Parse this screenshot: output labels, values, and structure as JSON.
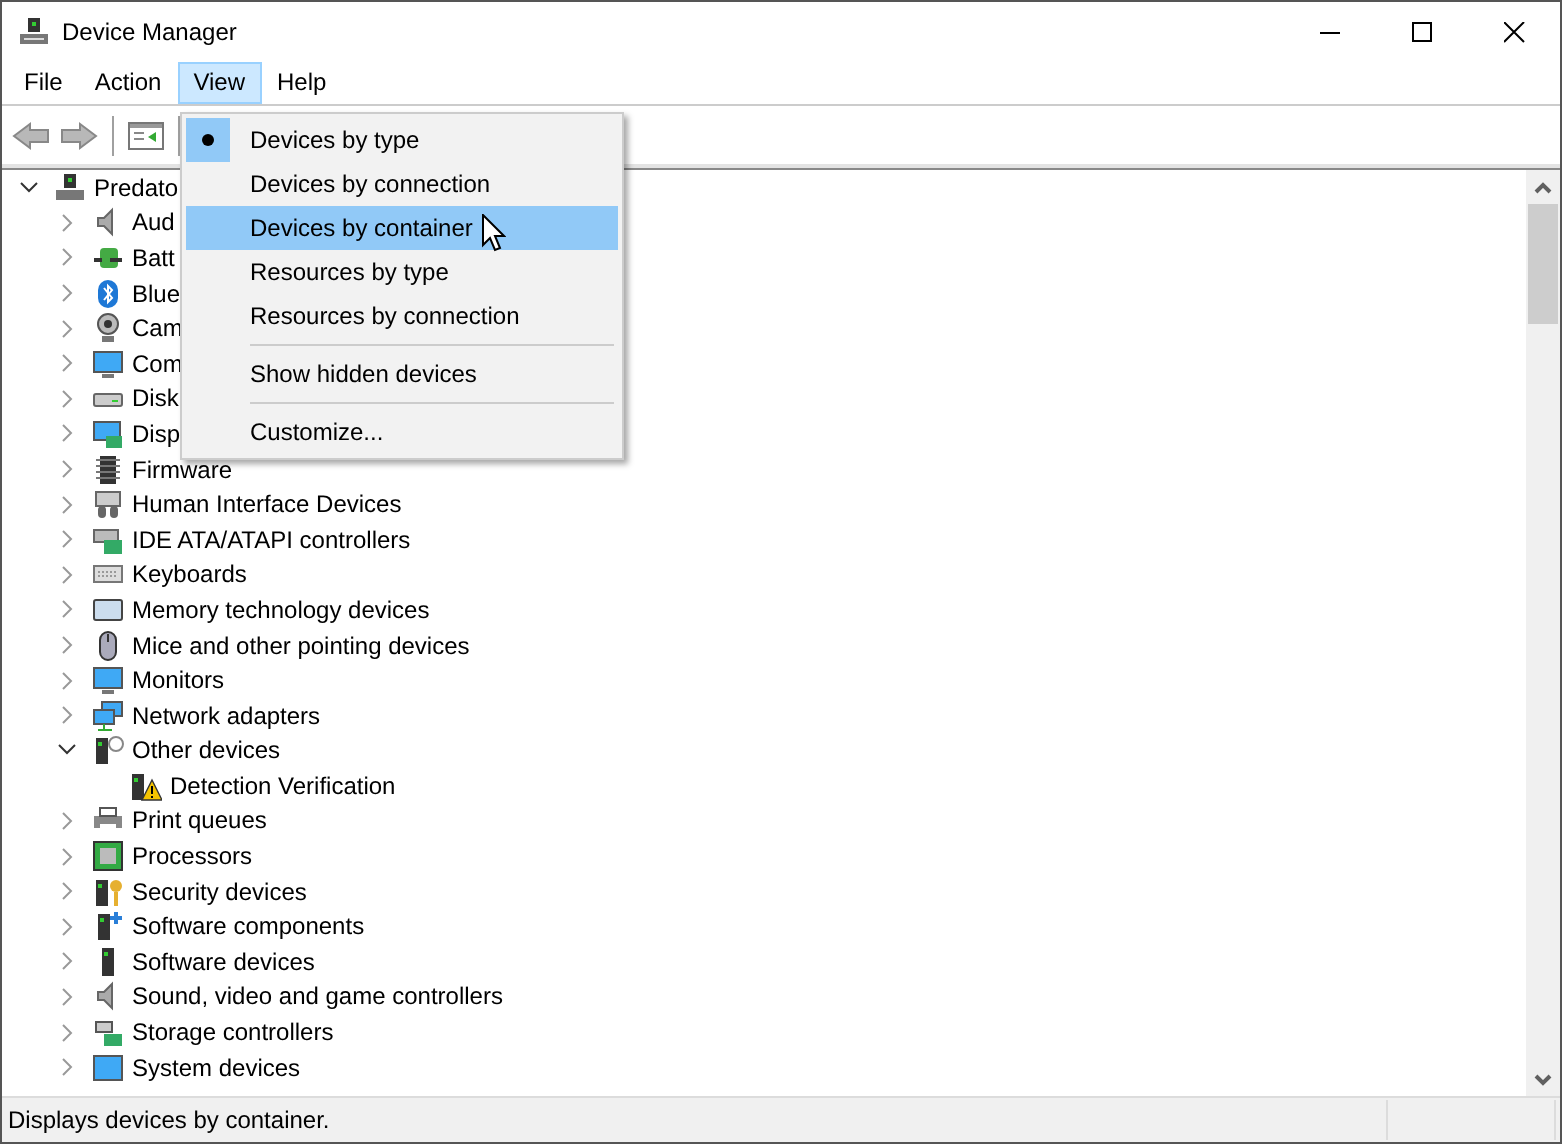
{
  "window": {
    "title": "Device Manager"
  },
  "menu_bar": [
    {
      "label": "File",
      "selected": false
    },
    {
      "label": "Action",
      "selected": false
    },
    {
      "label": "View",
      "selected": true
    },
    {
      "label": "Help",
      "selected": false
    }
  ],
  "view_menu": [
    {
      "kind": "item",
      "label": "Devices by type",
      "checked": true,
      "highlighted": false
    },
    {
      "kind": "item",
      "label": "Devices by connection",
      "checked": false,
      "highlighted": false
    },
    {
      "kind": "item",
      "label": "Devices by container",
      "checked": false,
      "highlighted": true
    },
    {
      "kind": "item",
      "label": "Resources by type",
      "checked": false,
      "highlighted": false
    },
    {
      "kind": "item",
      "label": "Resources by connection",
      "checked": false,
      "highlighted": false
    },
    {
      "kind": "separator"
    },
    {
      "kind": "item",
      "label": "Show hidden devices",
      "checked": false,
      "highlighted": false
    },
    {
      "kind": "separator"
    },
    {
      "kind": "item",
      "label": "Customize...",
      "checked": false,
      "highlighted": false
    }
  ],
  "tree": {
    "label": "Predato",
    "expanded": true,
    "children": [
      {
        "label": "Aud",
        "expanded": false
      },
      {
        "label": "Batt",
        "expanded": false
      },
      {
        "label": "Blue",
        "expanded": false
      },
      {
        "label": "Cam",
        "expanded": false
      },
      {
        "label": "Com",
        "expanded": false
      },
      {
        "label": "Disk",
        "expanded": false
      },
      {
        "label": "Disp",
        "expanded": false
      },
      {
        "label": "Firmware",
        "expanded": false
      },
      {
        "label": "Human Interface Devices",
        "expanded": false
      },
      {
        "label": "IDE ATA/ATAPI controllers",
        "expanded": false
      },
      {
        "label": "Keyboards",
        "expanded": false
      },
      {
        "label": "Memory technology devices",
        "expanded": false
      },
      {
        "label": "Mice and other pointing devices",
        "expanded": false
      },
      {
        "label": "Monitors",
        "expanded": false
      },
      {
        "label": "Network adapters",
        "expanded": false
      },
      {
        "label": "Other devices",
        "expanded": true,
        "children": [
          {
            "label": "Detection Verification"
          }
        ]
      },
      {
        "label": "Print queues",
        "expanded": false
      },
      {
        "label": "Processors",
        "expanded": false
      },
      {
        "label": "Security devices",
        "expanded": false
      },
      {
        "label": "Software components",
        "expanded": false
      },
      {
        "label": "Software devices",
        "expanded": false
      },
      {
        "label": "Sound, video and game controllers",
        "expanded": false
      },
      {
        "label": "Storage controllers",
        "expanded": false
      },
      {
        "label": "System devices",
        "expanded": false
      }
    ]
  },
  "status_bar": {
    "text": "Displays devices by container."
  }
}
